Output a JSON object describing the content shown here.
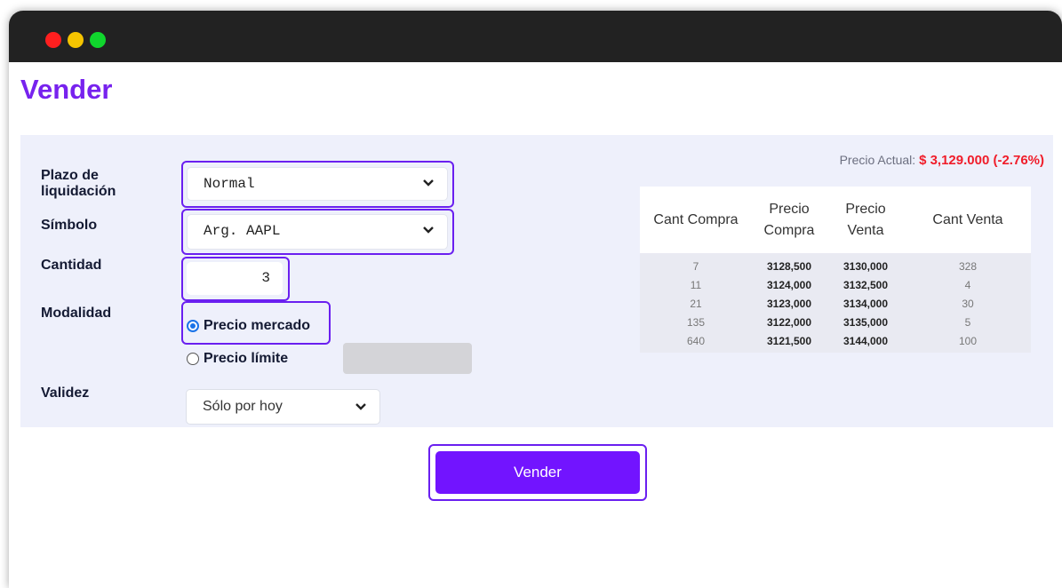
{
  "window": {
    "controls": [
      "close",
      "minimize",
      "maximize"
    ]
  },
  "page": {
    "title": "Vender"
  },
  "form": {
    "settlement": {
      "label": "Plazo de liquidación",
      "value": "Normal"
    },
    "symbol": {
      "label": "Símbolo",
      "value": "Arg. AAPL"
    },
    "quantity": {
      "label": "Cantidad",
      "value": "3"
    },
    "mode": {
      "label": "Modalidad",
      "options": [
        {
          "label": "Precio mercado",
          "selected": true
        },
        {
          "label": "Precio límite",
          "selected": false
        }
      ]
    },
    "validity": {
      "label": "Validez",
      "value": "Sólo por hoy"
    }
  },
  "current_price": {
    "label": "Precio Actual:",
    "value": "$ 3,129.000 (-2.76%)"
  },
  "order_book": {
    "headers": [
      "Cant Compra",
      "Precio Compra",
      "Precio Venta",
      "Cant Venta"
    ],
    "rows": [
      [
        "7",
        "3128,500",
        "3130,000",
        "328"
      ],
      [
        "11",
        "3124,000",
        "3132,500",
        "4"
      ],
      [
        "21",
        "3123,000",
        "3134,000",
        "30"
      ],
      [
        "135",
        "3122,000",
        "3135,000",
        "5"
      ],
      [
        "640",
        "3121,500",
        "3144,000",
        "100"
      ]
    ]
  },
  "actions": {
    "sell_label": "Vender"
  },
  "colors": {
    "accent": "#7214ff",
    "negative": "#f01d2a",
    "panel": "#eef0fb"
  }
}
